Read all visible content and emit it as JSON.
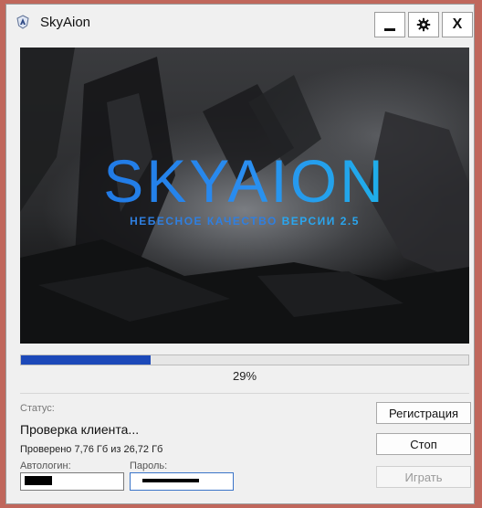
{
  "window": {
    "title": "SkyAion"
  },
  "titlebar": {
    "minimize_label": "",
    "settings_icon": "gear-icon",
    "close_label": "X"
  },
  "banner": {
    "logo": "SKYAION",
    "tagline_main": "НЕБЕСНОЕ КАЧЕСТВО",
    "tagline_highlight": "ВЕРСИИ 2.5"
  },
  "progress": {
    "percent": 29,
    "label": "29%"
  },
  "status": {
    "label": "Статус:",
    "text": "Проверка клиента...",
    "checked": "Проверено 7,76 Гб из 26,72 Гб"
  },
  "login": {
    "autologin_label": "Автологин:",
    "password_label": "Пароль:"
  },
  "buttons": {
    "register": "Регистрация",
    "stop": "Стоп",
    "play": "Играть"
  },
  "colors": {
    "progress": "#1c49b9",
    "logo_start": "#1b6fe0",
    "logo_end": "#19c4e6"
  }
}
